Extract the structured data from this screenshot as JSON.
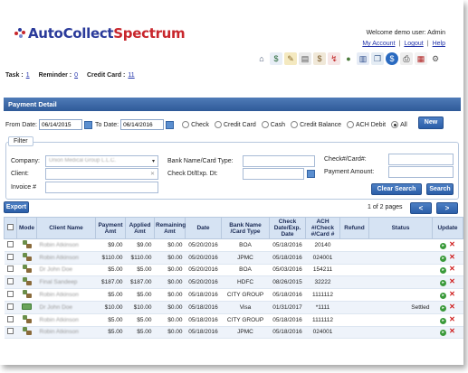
{
  "app": {
    "logo_part1": "AutoCollect",
    "logo_part2": "Spectrum",
    "welcome": "Welcome demo user:  Admin",
    "links": [
      "My Account",
      "Logout",
      "Help"
    ]
  },
  "icons": [
    "home-icon",
    "invoice-icon",
    "notepad-icon",
    "edit-icon",
    "payment-icon",
    "collection-icon",
    "users-icon",
    "book-icon",
    "documents-icon",
    "dollar-icon",
    "print-icon",
    "calendar-icon",
    "settings-icon"
  ],
  "counts": {
    "task_label": "Task :",
    "task_value": "1",
    "reminder_label": "Reminder :",
    "reminder_value": "0",
    "credit_label": "Credit Card :",
    "credit_value": "11"
  },
  "panel": {
    "title": "Payment Detail",
    "from_label": "From Date:",
    "from_value": "06/14/2015",
    "to_label": "To Date:",
    "to_value": "06/14/2016",
    "radios": [
      "Check",
      "Credit Card",
      "Cash",
      "Credit Balance",
      "ACH Debit",
      "All"
    ],
    "selected_radio": "All",
    "new_label": "New"
  },
  "filter": {
    "tab": "Filter",
    "company_label": "Company:",
    "company_value": "Union Medical Group L.L.C.",
    "client_label": "Client:",
    "invoice_label": "Invoice #",
    "bank_label": "Bank Name/Card Type:",
    "check_dt_label": "Check Dt/Exp. Dt:",
    "check_no_label": "Check#/Card#:",
    "amount_label": "Payment Amount:",
    "clear_label": "Clear Search",
    "search_label": "Search"
  },
  "list": {
    "export_label": "Export",
    "pager": "1 of 2 pages",
    "prev": "<",
    "next": ">"
  },
  "table": {
    "headers": [
      "",
      "Mode",
      "Client Name",
      "Payment Amt",
      "Applied Amt",
      "Remaining Amt",
      "Date",
      "Bank Name /Card Type",
      "Check Date/Exp. Date",
      "ACH #/Check #/Card #",
      "Refund",
      "Status",
      "Update"
    ],
    "rows": [
      {
        "mode": "check",
        "client": "Robin Atkinson",
        "payment": "$9.00",
        "applied": "$9.00",
        "remaining": "$0.00",
        "date": "05/20/2016",
        "bank": "BOA",
        "check_date": "05/18/2016",
        "number": "20140",
        "refund": "",
        "status": ""
      },
      {
        "mode": "check",
        "client": "Robin Atkinson",
        "payment": "$110.00",
        "applied": "$110.00",
        "remaining": "$0.00",
        "date": "05/20/2016",
        "bank": "JPMC",
        "check_date": "05/18/2016",
        "number": "024001",
        "refund": "",
        "status": ""
      },
      {
        "mode": "check",
        "client": "Dr John Doe",
        "payment": "$5.00",
        "applied": "$5.00",
        "remaining": "$0.00",
        "date": "05/20/2016",
        "bank": "BOA",
        "check_date": "05/03/2016",
        "number": "154211",
        "refund": "",
        "status": ""
      },
      {
        "mode": "check",
        "client": "Final Sandeep",
        "payment": "$187.00",
        "applied": "$187.00",
        "remaining": "$0.00",
        "date": "05/20/2016",
        "bank": "HDFC",
        "check_date": "08/26/2015",
        "number": "32222",
        "refund": "",
        "status": ""
      },
      {
        "mode": "check",
        "client": "Robin Atkinson",
        "payment": "$5.00",
        "applied": "$5.00",
        "remaining": "$0.00",
        "date": "05/18/2016",
        "bank": "CITY GROUP",
        "check_date": "05/18/2016",
        "number": "1111112",
        "refund": "",
        "status": ""
      },
      {
        "mode": "card",
        "client": "Dr John Doe",
        "payment": "$10.00",
        "applied": "$10.00",
        "remaining": "$0.00",
        "date": "05/18/2016",
        "bank": "Visa",
        "check_date": "01/31/2017",
        "number": "*1111",
        "refund": "",
        "status": "Settled"
      },
      {
        "mode": "check",
        "client": "Robin Atkinson",
        "payment": "$5.00",
        "applied": "$5.00",
        "remaining": "$0.00",
        "date": "05/18/2016",
        "bank": "CITY GROUP",
        "check_date": "05/18/2016",
        "number": "1111112",
        "refund": "",
        "status": ""
      },
      {
        "mode": "check",
        "client": "Robin Atkinson",
        "payment": "$5.00",
        "applied": "$5.00",
        "remaining": "$0.00",
        "date": "05/18/2016",
        "bank": "JPMC",
        "check_date": "05/18/2016",
        "number": "024001",
        "refund": "",
        "status": ""
      }
    ]
  }
}
